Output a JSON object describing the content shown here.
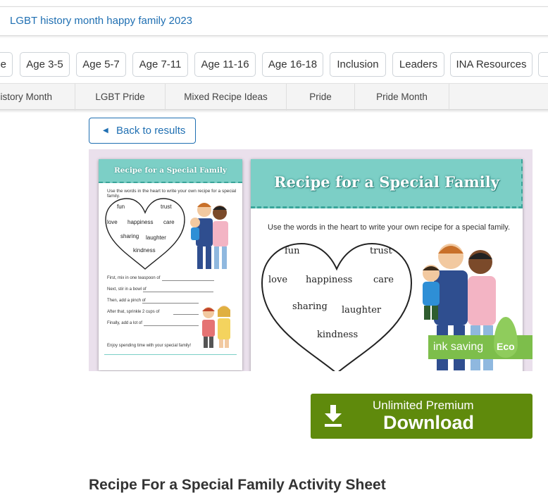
{
  "search": {
    "query": "LGBT history month happy family 2023"
  },
  "tags": [
    "e",
    "Age 3-5",
    "Age 5-7",
    "Age 7-11",
    "Age 11-16",
    "Age 16-18",
    "Inclusion",
    "Leaders",
    "INA Resources",
    ""
  ],
  "subnav": [
    "listory Month",
    "LGBT Pride",
    "Mixed Recipe Ideas",
    "Pride",
    "Pride Month"
  ],
  "back_button": {
    "label": "Back to results",
    "icon": "triangle-left-icon"
  },
  "preview": {
    "thumb": {
      "title": "Recipe for a Special Family",
      "instruction": "Use the words in the heart to write your own recipe for a special family.",
      "words": [
        "fun",
        "trust",
        "love",
        "happiness",
        "care",
        "sharing",
        "laughter",
        "kindness"
      ],
      "lines": [
        "First, mix in one teaspoon of",
        "Next, stir in a bowl of",
        "Then, add a pinch of",
        "After that, sprinkle 2 cups of",
        "Finally, add a lot of"
      ],
      "closing": "Enjoy spending time with your special family!"
    },
    "main": {
      "title": "Recipe for a Special Family",
      "instruction": "Use the words in the heart to write your own recipe for a special family.",
      "words": [
        "fun",
        "trust",
        "love",
        "happiness",
        "care",
        "sharing",
        "laughter",
        "kindness"
      ]
    },
    "badge": {
      "text": "ink saving",
      "eco": "Eco",
      "color": "#7dbe4b"
    }
  },
  "download": {
    "line1": "Unlimited Premium",
    "line2": "Download",
    "color": "#5f8a0c",
    "icon": "download-icon"
  },
  "page_title": "Recipe For a Special Family Activity Sheet"
}
